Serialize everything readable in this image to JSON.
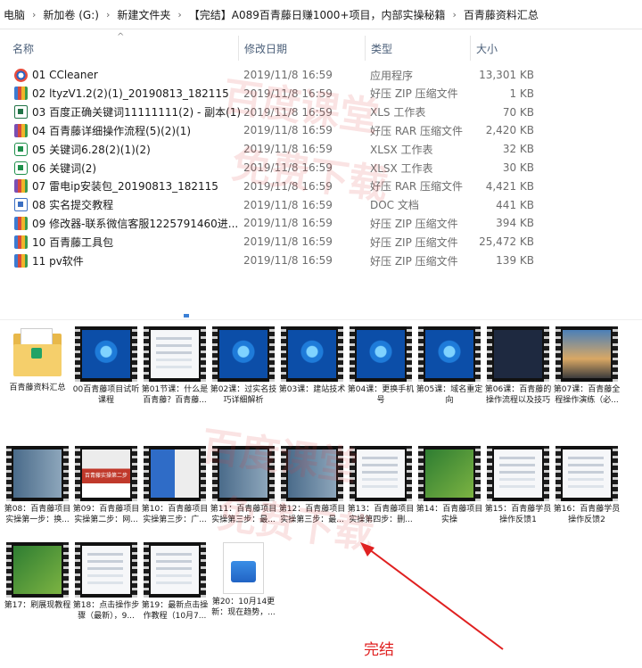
{
  "breadcrumb": [
    "电脑",
    "新加卷 (G:)",
    "新建文件夹",
    "【完结】A089百青藤日赚1000+项目，内部实操秘籍",
    "百青藤资料汇总"
  ],
  "columns": {
    "name": "名称",
    "date": "修改日期",
    "type": "类型",
    "size": "大小"
  },
  "files": [
    {
      "name": "01 CCleaner",
      "date": "2019/11/8 16:59",
      "type": "应用程序",
      "size": "13,301 KB",
      "icon": "app-icon"
    },
    {
      "name": "02 ltyzV1.2(2)(1)_20190813_182115",
      "date": "2019/11/8 16:59",
      "type": "好压 ZIP 压缩文件",
      "size": "1 KB",
      "icon": "zip-icon"
    },
    {
      "name": "03 百度正确关键词11111111(2) - 副本(1)",
      "date": "2019/11/8 16:59",
      "type": "XLS 工作表",
      "size": "70 KB",
      "icon": "xls-icon"
    },
    {
      "name": "04 百青藤详细操作流程(5)(2)(1)",
      "date": "2019/11/8 16:59",
      "type": "好压 RAR 压缩文件",
      "size": "2,420 KB",
      "icon": "rar-icon"
    },
    {
      "name": "05 关键词6.28(2)(1)(2)",
      "date": "2019/11/8 16:59",
      "type": "XLSX 工作表",
      "size": "32 KB",
      "icon": "xlsx-icon"
    },
    {
      "name": "06 关键词(2)",
      "date": "2019/11/8 16:59",
      "type": "XLSX 工作表",
      "size": "30 KB",
      "icon": "xlsx-icon"
    },
    {
      "name": "07 雷电ip安装包_20190813_182115",
      "date": "2019/11/8 16:59",
      "type": "好压 RAR 压缩文件",
      "size": "4,421 KB",
      "icon": "rar-icon"
    },
    {
      "name": "08 实名提交教程",
      "date": "2019/11/8 16:59",
      "type": "DOC 文档",
      "size": "441 KB",
      "icon": "doc-icon"
    },
    {
      "name": "09 修改器-联系微信客服1225791460进...",
      "date": "2019/11/8 16:59",
      "type": "好压 ZIP 压缩文件",
      "size": "394 KB",
      "icon": "zip-icon"
    },
    {
      "name": "10 百青藤工具包",
      "date": "2019/11/8 16:59",
      "type": "好压 ZIP 压缩文件",
      "size": "25,472 KB",
      "icon": "zip-icon"
    },
    {
      "name": "11 pv软件",
      "date": "2019/11/8 16:59",
      "type": "好压 ZIP 压缩文件",
      "size": "139 KB",
      "icon": "zip-icon"
    }
  ],
  "tiles": [
    {
      "caption": "百青藤资料汇总",
      "thumb": "folder"
    },
    {
      "caption": "00百青藤项目试听课程",
      "thumb": "win"
    },
    {
      "caption": "第01节课：什么是百青藤？百青藤...",
      "thumb": "page"
    },
    {
      "caption": "第02课：过实名技巧详细解析",
      "thumb": "win"
    },
    {
      "caption": "第03课：建站技术",
      "thumb": "win"
    },
    {
      "caption": "第04课：更换手机号",
      "thumb": "win"
    },
    {
      "caption": "第05课：域名重定向",
      "thumb": "win"
    },
    {
      "caption": "第06课：百青藤的操作流程以及技巧",
      "thumb": "dark"
    },
    {
      "caption": "第07课：百青藤全程操作演练（必...",
      "thumb": "sky"
    },
    {
      "caption": "第08：百青藤项目实操第一步：换...",
      "thumb": "desk"
    },
    {
      "caption": "第09：百青藤项目实操第二步：网...",
      "thumb": "red"
    },
    {
      "caption": "第10：百青藤项目实操第三步：广...",
      "thumb": "mixed"
    },
    {
      "caption": "第11：百青藤项目实操第三步：最...",
      "thumb": "desk"
    },
    {
      "caption": "第12：百青藤项目实操第三步：最...",
      "thumb": "desk"
    },
    {
      "caption": "第13：百青藤项目实操第四步：删...",
      "thumb": "page"
    },
    {
      "caption": "第14：百青藤项目实操",
      "thumb": "green"
    },
    {
      "caption": "第15：百青藤学员操作反馈1",
      "thumb": "page"
    },
    {
      "caption": "第16：百青藤学员操作反馈2",
      "thumb": "page"
    },
    {
      "caption": "第17：刷展现教程",
      "thumb": "green"
    },
    {
      "caption": "第18：点击操作步骤（最新），9...",
      "thumb": "page"
    },
    {
      "caption": "第19：最新点击操作教程（10月7...",
      "thumb": "page"
    },
    {
      "caption": "第20：10月14更新：现在趋势，...",
      "thumb": "clip"
    }
  ],
  "red_thumb_text": "百青藤实操第二步",
  "watermark": [
    "百度课堂",
    "免费下载",
    "百度课堂",
    "免费下载"
  ],
  "annotation": "完结",
  "colors": {
    "annotation": "#e02020",
    "header": "#4c607a"
  }
}
